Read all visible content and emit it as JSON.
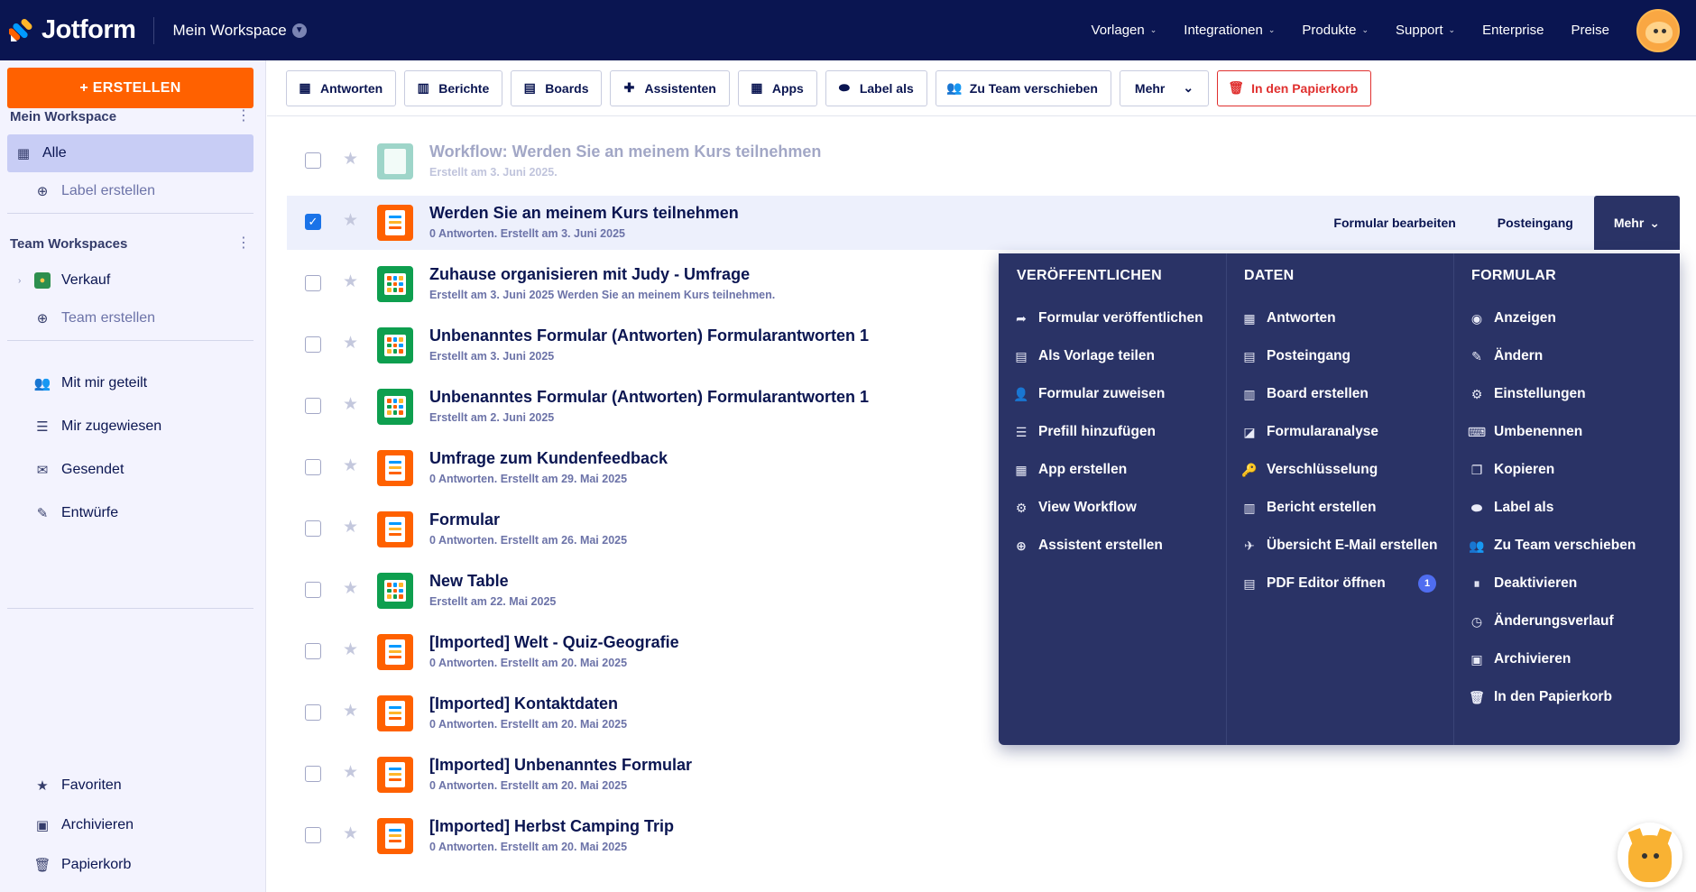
{
  "brand": {
    "name": "Jotform",
    "accent": "#ff6100",
    "navy": "#0a1551"
  },
  "topnav": {
    "workspace": "Mein Workspace",
    "links": [
      {
        "label": "Vorlagen",
        "chevron": true
      },
      {
        "label": "Integrationen",
        "chevron": true
      },
      {
        "label": "Produkte",
        "chevron": true
      },
      {
        "label": "Support",
        "chevron": true
      },
      {
        "label": "Enterprise",
        "chevron": false
      },
      {
        "label": "Preise",
        "chevron": false
      }
    ],
    "chevron_glyph": "⌄",
    "avatar_icon": "user-avatar-cat"
  },
  "sidebar": {
    "create_label": "+ ERSTELLEN",
    "my_workspace_title": "Mein Workspace",
    "kebab": "⋮",
    "my_items": [
      {
        "label": "Alle",
        "icon": "grid-icon",
        "glyph": "▦"
      },
      {
        "label": "Label erstellen",
        "icon": "plus-circle-icon",
        "glyph": "⊕"
      }
    ],
    "team_title": "Team Workspaces",
    "team_items": [
      {
        "label": "Verkauf",
        "icon": "team-avatar-icon",
        "glyph": "▪"
      },
      {
        "label": "Team erstellen",
        "icon": "plus-circle-icon",
        "glyph": "⊕"
      }
    ],
    "lists": [
      {
        "label": "Mit mir geteilt",
        "icon": "shared-users-icon",
        "glyph": "👥"
      },
      {
        "label": "Mir zugewiesen",
        "icon": "assigned-list-icon",
        "glyph": "☰"
      },
      {
        "label": "Gesendet",
        "icon": "sent-message-icon",
        "glyph": "✉"
      },
      {
        "label": "Entwürfe",
        "icon": "drafts-icon",
        "glyph": "✎"
      }
    ],
    "bottom": [
      {
        "label": "Favoriten",
        "icon": "star-icon",
        "glyph": "★"
      },
      {
        "label": "Archivieren",
        "icon": "archive-icon",
        "glyph": "▣"
      },
      {
        "label": "Papierkorb",
        "icon": "trash-icon",
        "glyph": "🗑"
      }
    ]
  },
  "toolbar": {
    "buttons": [
      {
        "label": "Antworten",
        "icon": "table-icon",
        "glyph": "▦"
      },
      {
        "label": "Berichte",
        "icon": "report-icon",
        "glyph": "▥"
      },
      {
        "label": "Boards",
        "icon": "board-icon",
        "glyph": "▤"
      },
      {
        "label": "Assistenten",
        "icon": "assistant-icon",
        "glyph": "✚"
      },
      {
        "label": "Apps",
        "icon": "apps-icon",
        "glyph": "▦"
      },
      {
        "label": "Label als",
        "icon": "label-icon",
        "glyph": "⬬"
      },
      {
        "label": "Zu Team verschieben",
        "icon": "move-team-icon",
        "glyph": "👥"
      }
    ],
    "more_label": "Mehr",
    "more_chevron": "⌄",
    "trash_label": "In den Papierkorb",
    "trash_glyph": "🗑"
  },
  "forms": [
    {
      "title": "Workflow: Werden Sie an meinem Kurs teilnehmen",
      "sub": "Erstellt am 3. Juni 2025.",
      "type": "workflow",
      "faded": true,
      "checked": false
    },
    {
      "title": "Werden Sie an meinem Kurs teilnehmen",
      "sub": "0 Antworten. Erstellt am 3. Juni 2025",
      "type": "form",
      "selected": true,
      "checked": true
    },
    {
      "title": "Zuhause organisieren mit Judy - Umfrage",
      "sub": "Erstellt am 3. Juni 2025 Werden Sie an meinem Kurs teilnehmen.",
      "type": "table"
    },
    {
      "title": "Unbenanntes Formular (Antworten) Formularantworten 1",
      "sub": "Erstellt am 3. Juni 2025",
      "type": "table"
    },
    {
      "title": "Unbenanntes Formular (Antworten) Formularantworten 1",
      "sub": "Erstellt am 2. Juni 2025",
      "type": "table"
    },
    {
      "title": "Umfrage zum Kundenfeedback",
      "sub": "0 Antworten. Erstellt am 29. Mai 2025",
      "type": "form"
    },
    {
      "title": "Formular",
      "sub": "0 Antworten. Erstellt am 26. Mai 2025",
      "type": "form"
    },
    {
      "title": "New Table",
      "sub": "Erstellt am 22. Mai 2025",
      "type": "table"
    },
    {
      "title": "[Imported] Welt - Quiz-Geografie",
      "sub": "0 Antworten. Erstellt am 20. Mai 2025",
      "type": "form"
    },
    {
      "title": "[Imported] Kontaktdaten",
      "sub": "0 Antworten. Erstellt am 20. Mai 2025",
      "type": "form"
    },
    {
      "title": "[Imported] Unbenanntes Formular",
      "sub": "0 Antworten. Erstellt am 20. Mai 2025",
      "type": "form"
    },
    {
      "title": "[Imported] Herbst Camping Trip",
      "sub": "0 Antworten. Erstellt am 20. Mai 2025",
      "type": "form"
    }
  ],
  "row_actions": {
    "edit": "Formular bearbeiten",
    "inbox": "Posteingang",
    "more": "Mehr",
    "more_chevron": "⌄",
    "checkmark": "✓",
    "star": "★"
  },
  "dropdown": {
    "columns": [
      {
        "title": "VERÖFFENTLICHEN",
        "items": [
          {
            "label": "Formular veröffentlichen",
            "icon": "share-arrow-icon",
            "glyph": "➦"
          },
          {
            "label": "Als Vorlage teilen",
            "icon": "template-share-icon",
            "glyph": "▤"
          },
          {
            "label": "Formular zuweisen",
            "icon": "assign-user-icon",
            "glyph": "👤"
          },
          {
            "label": "Prefill hinzufügen",
            "icon": "prefill-icon",
            "glyph": "☰"
          },
          {
            "label": "App erstellen",
            "icon": "app-create-icon",
            "glyph": "▦"
          },
          {
            "label": "View Workflow",
            "icon": "workflow-icon",
            "glyph": "⚙"
          },
          {
            "label": "Assistent erstellen",
            "icon": "plus-circle-icon",
            "glyph": "⊕"
          }
        ]
      },
      {
        "title": "DATEN",
        "items": [
          {
            "label": "Antworten",
            "icon": "table-icon",
            "glyph": "▦"
          },
          {
            "label": "Posteingang",
            "icon": "inbox-icon",
            "glyph": "▤"
          },
          {
            "label": "Board erstellen",
            "icon": "board-icon",
            "glyph": "▥"
          },
          {
            "label": "Formularanalyse",
            "icon": "analytics-icon",
            "glyph": "◪"
          },
          {
            "label": "Verschlüsselung",
            "icon": "key-icon",
            "glyph": "🔑"
          },
          {
            "label": "Bericht erstellen",
            "icon": "report-icon",
            "glyph": "▥"
          },
          {
            "label": "Übersicht E-Mail erstellen",
            "icon": "send-email-icon",
            "glyph": "✈"
          },
          {
            "label": "PDF Editor öffnen",
            "icon": "pdf-icon",
            "glyph": "▤",
            "badge": "1"
          }
        ]
      },
      {
        "title": "FORMULAR",
        "items": [
          {
            "label": "Anzeigen",
            "icon": "eye-icon",
            "glyph": "◉"
          },
          {
            "label": "Ändern",
            "icon": "edit-icon",
            "glyph": "✎"
          },
          {
            "label": "Einstellungen",
            "icon": "gear-icon",
            "glyph": "⚙"
          },
          {
            "label": "Umbenennen",
            "icon": "rename-icon",
            "glyph": "⌨"
          },
          {
            "label": "Kopieren",
            "icon": "copy-icon",
            "glyph": "❐"
          },
          {
            "label": "Label als",
            "icon": "label-icon",
            "glyph": "⬬"
          },
          {
            "label": "Zu Team verschieben",
            "icon": "move-team-icon",
            "glyph": "👥"
          },
          {
            "label": "Deaktivieren",
            "icon": "pause-icon",
            "glyph": "⏸"
          },
          {
            "label": "Änderungsverlauf",
            "icon": "history-icon",
            "glyph": "◷"
          },
          {
            "label": "Archivieren",
            "icon": "archive-icon",
            "glyph": "▣"
          },
          {
            "label": "In den Papierkorb",
            "icon": "trash-icon",
            "glyph": "🗑"
          }
        ]
      }
    ]
  }
}
